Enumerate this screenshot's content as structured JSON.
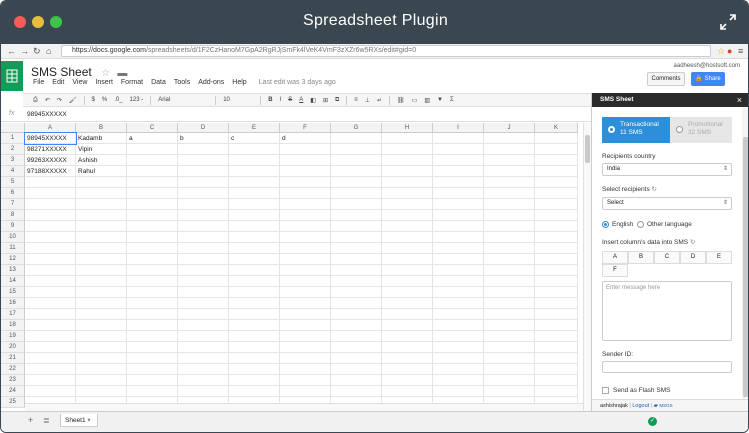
{
  "window": {
    "title": "Spreadsheet Plugin",
    "dots": [
      "#fc5b57",
      "#e5bf3c",
      "#3dc54b"
    ],
    "bg": "#3a4750"
  },
  "browser": {
    "url_host": "https://docs.google.com",
    "url_path": "/spreadsheets/d/1F2CzHanoM7GpA2RgRJjSmFk4lVeK4VmF3zXZr6w5RXs/edit#gid=0"
  },
  "app": {
    "doc_title": "SMS Sheet",
    "menus": [
      "File",
      "Edit",
      "View",
      "Insert",
      "Format",
      "Data",
      "Tools",
      "Add-ons",
      "Help"
    ],
    "last_edit": "Last edit was 3 days ago",
    "user_email": "aadheesh@hostsoft.com",
    "comments_label": "Comments",
    "share_label": "Share",
    "brand_color": "#0f9d58"
  },
  "toolbar": {
    "currency": "$",
    "percent": "%",
    "decimal": ".0_",
    "more_formats": "123 -",
    "font": "Arial",
    "font_size": "10",
    "bold": "B",
    "italic": "I",
    "strike": "S",
    "text_color": "A",
    "sum": "Σ"
  },
  "formula": {
    "fx": "fx",
    "value": "98945XXXXX"
  },
  "sheet": {
    "columns": [
      "A",
      "B",
      "C",
      "D",
      "E",
      "F",
      "G",
      "H",
      "I",
      "J",
      "K"
    ],
    "rows": [
      "1",
      "2",
      "3",
      "4",
      "5",
      "6",
      "7",
      "8",
      "9",
      "10",
      "11",
      "12",
      "13",
      "14",
      "15",
      "16",
      "17",
      "18",
      "19",
      "20",
      "21",
      "22",
      "23",
      "24",
      "25"
    ],
    "cells": {
      "a1": "98945XXXXX",
      "b1": "Kadamb",
      "c1": "a",
      "d1": "b",
      "e1": "c",
      "f1": "d",
      "a2": "98271XXXXX",
      "b2": "Vipin",
      "a3": "99263XXXXX",
      "b3": "Ashish",
      "a4": "97188XXXXX",
      "b4": "Rahul"
    },
    "tab_name": "Sheet1"
  },
  "panel": {
    "title": "SMS Sheet",
    "close": "×",
    "transactional_title": "Transactional",
    "transactional_count": "11 SMS",
    "promotional_title": "Promotional",
    "promotional_count": "32 SMS",
    "recipients_country_label": "Recipients country",
    "country_value": "India",
    "select_recipients_label": "Select recipients",
    "recipients_value": "Select",
    "lang_english": "English",
    "lang_other": "Other language",
    "insert_col_label": "Insert column's data into SMS",
    "col_buttons": [
      "A",
      "B",
      "C",
      "D",
      "E",
      "F"
    ],
    "message_placeholder": "Enter message here",
    "sender_label": "Sender ID:",
    "flash_label": "Send as Flash SMS",
    "footer_user": "ashishrajak",
    "footer_logout": "Logout",
    "footer_brand": "MSGS",
    "accent": "#2b8fd9"
  }
}
